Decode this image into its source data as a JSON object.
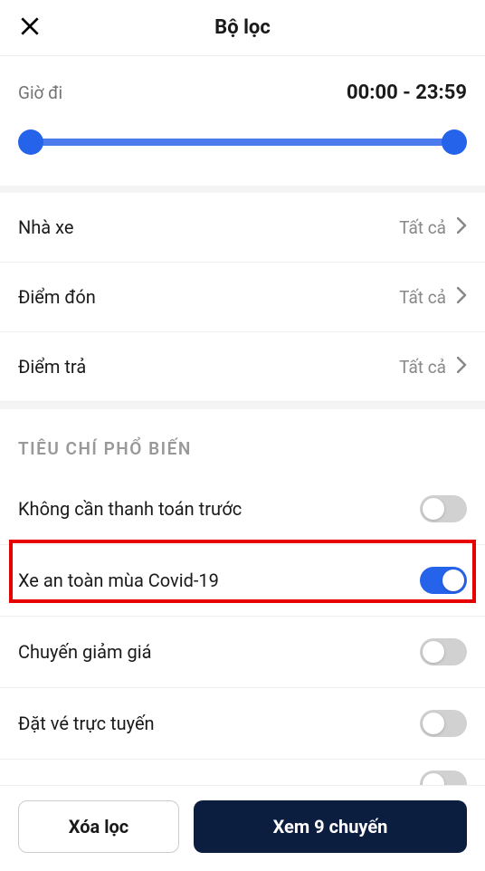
{
  "header": {
    "title": "Bộ lọc"
  },
  "time": {
    "label": "Giờ đi",
    "value": "00:00 - 23:59"
  },
  "rows": [
    {
      "label": "Nhà xe",
      "value": "Tất cả"
    },
    {
      "label": "Điểm đón",
      "value": "Tất cả"
    },
    {
      "label": "Điểm trả",
      "value": "Tất cả"
    }
  ],
  "section": {
    "title": "TIÊU CHÍ PHỔ BIẾN"
  },
  "toggles": [
    {
      "label": "Không cần thanh toán trước",
      "on": false
    },
    {
      "label": "Xe an toàn mùa Covid-19",
      "on": true
    },
    {
      "label": "Chuyến giảm giá",
      "on": false
    },
    {
      "label": "Đặt vé trực tuyến",
      "on": false
    }
  ],
  "buttons": {
    "clear": "Xóa lọc",
    "submit": "Xem 9 chuyến"
  }
}
